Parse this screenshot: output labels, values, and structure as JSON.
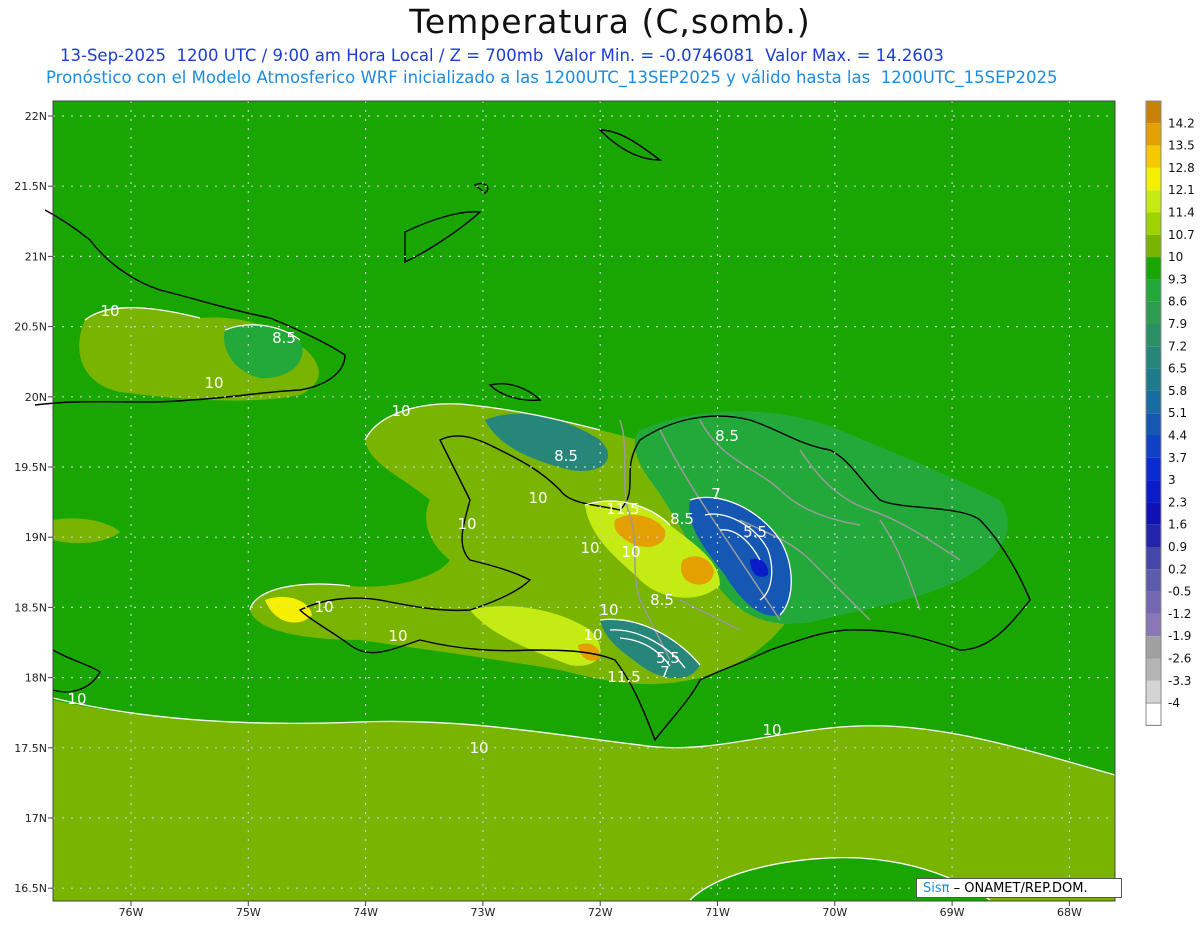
{
  "title": "Temperatura (C,somb.)",
  "subtitle_line1": "13-Sep-2025  1200 UTC / 9:00 am Hora Local / Z = 700mb  Valor Min. = -0.0746081  Valor Max. = 14.2603",
  "subtitle_line2": "Pronóstico con el Modelo Atmosferico WRF inicializado a las 1200UTC_13SEP2025 y válido hasta las  1200UTC_15SEP2025",
  "lat_labels": [
    "22N",
    "21.5N",
    "21N",
    "20.5N",
    "20N",
    "19.5N",
    "19N",
    "18.5N",
    "18N",
    "17.5N",
    "17N",
    "16.5N"
  ],
  "lon_labels": [
    "76W",
    "75W",
    "74W",
    "73W",
    "72W",
    "71W",
    "70W",
    "69W",
    "68W"
  ],
  "colorbar": {
    "labels": [
      "14.2",
      "13.5",
      "12.8",
      "12.1",
      "11.4",
      "10.7",
      "10",
      "9.3",
      "8.6",
      "7.9",
      "7.2",
      "6.5",
      "5.8",
      "5.1",
      "4.4",
      "3.7",
      "3",
      "2.3",
      "1.6",
      "0.9",
      "0.2",
      "-0.5",
      "-1.2",
      "-1.9",
      "-2.6",
      "-3.3",
      "-4"
    ],
    "colors": [
      "#c8820a",
      "#e4a000",
      "#f5c800",
      "#f5f000",
      "#c4ec14",
      "#9ed200",
      "#78b400",
      "#19a600",
      "#23a83a",
      "#2e9c50",
      "#2a9064",
      "#26867a",
      "#1f7a8c",
      "#196ca2",
      "#1558b4",
      "#1040c4",
      "#0a2bd2",
      "#0a1cc8",
      "#1010b4",
      "#2424aa",
      "#4646a8",
      "#5c5cac",
      "#7468b2",
      "#8a78b6",
      "#a0a0a0",
      "#b4b4b4",
      "#d4d4d4"
    ]
  },
  "contour_labels": [
    "10",
    "8.5",
    "10",
    "10",
    "8.5",
    "10",
    "10",
    "10",
    "11.5",
    "8.5",
    "7",
    "5.5",
    "10",
    "8.5",
    "10",
    "11.5",
    "7",
    "5.5",
    "10",
    "10",
    "10",
    "10",
    "10"
  ],
  "credit": {
    "brand": "Sisπ",
    "text": " – ONAMET/REP.DOM."
  }
}
